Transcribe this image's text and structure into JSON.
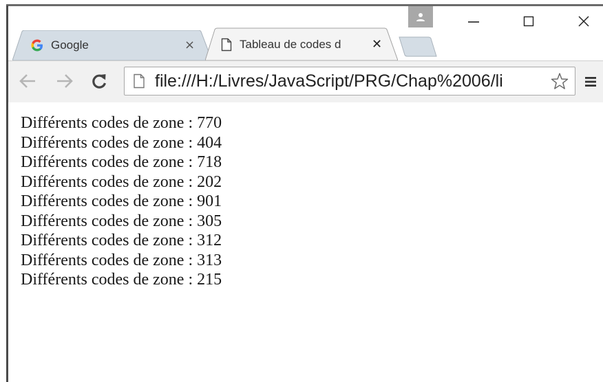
{
  "window": {
    "controls": {
      "profile_icon": "person-icon",
      "minimize_icon": "minimize-icon",
      "maximize_icon": "maximize-icon",
      "close_icon": "close-icon"
    }
  },
  "tabs": [
    {
      "label": "Google",
      "icon": "google-g-icon",
      "active": false,
      "close": "×"
    },
    {
      "label": "Tableau de codes d",
      "icon": "page-icon",
      "active": true,
      "close": "✕"
    }
  ],
  "toolbar": {
    "back_icon": "arrow-left-icon",
    "forward_icon": "arrow-right-icon",
    "reload_icon": "reload-icon",
    "url": "file:///H:/Livres/JavaScript/PRG/Chap%2006/li",
    "bookmark_icon": "star-icon",
    "menu_icon": "hamburger-menu-icon"
  },
  "content": {
    "lines": [
      "Différents codes de zone : 770",
      "Différents codes de zone : 404",
      "Différents codes de zone : 718",
      "Différents codes de zone : 202",
      "Différents codes de zone : 901",
      "Différents codes de zone : 305",
      "Différents codes de zone : 312",
      "Différents codes de zone : 313",
      "Différents codes de zone : 215"
    ]
  },
  "colors": {
    "tab_inactive": "#d4dde5",
    "tab_active": "#f4f4f4",
    "toolbar": "#f1f1f1",
    "google_blue": "#4285f4"
  }
}
